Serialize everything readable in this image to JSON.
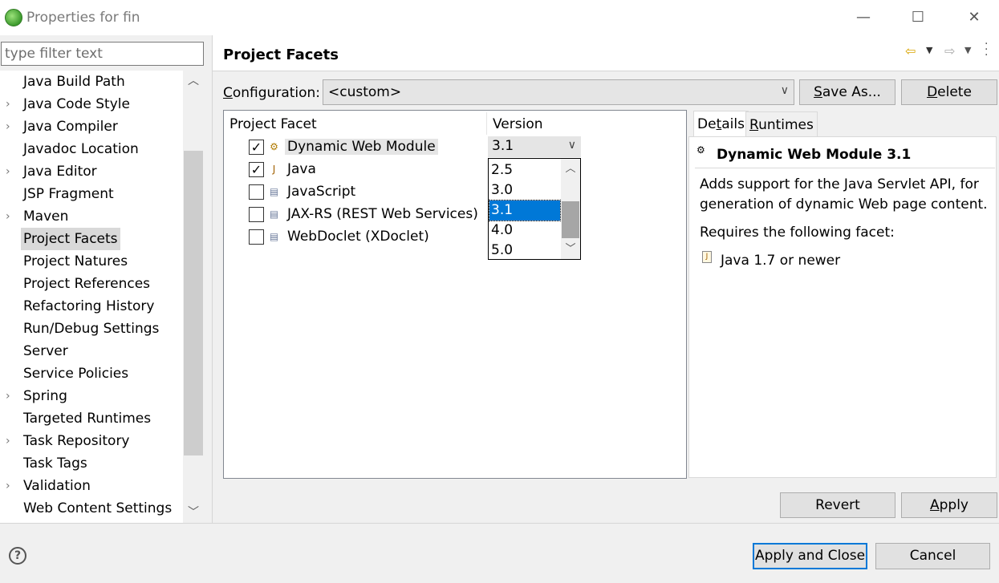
{
  "window": {
    "title": "Properties for fin",
    "controls": {
      "minimize": "—",
      "maximize": "☐",
      "close": "✕"
    }
  },
  "filter": {
    "placeholder": "type filter text",
    "value": ""
  },
  "tree": {
    "items": [
      {
        "label": "Java Build Path",
        "expandable": false
      },
      {
        "label": "Java Code Style",
        "expandable": true
      },
      {
        "label": "Java Compiler",
        "expandable": true
      },
      {
        "label": "Javadoc Location",
        "expandable": false
      },
      {
        "label": "Java Editor",
        "expandable": true
      },
      {
        "label": "JSP Fragment",
        "expandable": false
      },
      {
        "label": "Maven",
        "expandable": true
      },
      {
        "label": "Project Facets",
        "expandable": false,
        "selected": true
      },
      {
        "label": "Project Natures",
        "expandable": false
      },
      {
        "label": "Project References",
        "expandable": false
      },
      {
        "label": "Refactoring History",
        "expandable": false
      },
      {
        "label": "Run/Debug Settings",
        "expandable": false
      },
      {
        "label": "Server",
        "expandable": false
      },
      {
        "label": "Service Policies",
        "expandable": false
      },
      {
        "label": "Spring",
        "expandable": true
      },
      {
        "label": "Targeted Runtimes",
        "expandable": false
      },
      {
        "label": "Task Repository",
        "expandable": true
      },
      {
        "label": "Task Tags",
        "expandable": false
      },
      {
        "label": "Validation",
        "expandable": true
      },
      {
        "label": "Web Content Settings",
        "expandable": false
      }
    ]
  },
  "page": {
    "title": "Project Facets"
  },
  "configuration": {
    "label_prefix": "C",
    "label_rest": "onfiguration:",
    "value": "<custom>",
    "save_as_u": "S",
    "save_as_rest": "ave As...",
    "delete_u": "D",
    "delete_rest": "elete"
  },
  "facets": {
    "col_facet": "Project Facet",
    "col_version": "Version",
    "rows": [
      {
        "name": "Dynamic Web Module",
        "checked": true,
        "icon": "web-module-icon"
      },
      {
        "name": "Java",
        "checked": true,
        "icon": "java-icon"
      },
      {
        "name": "JavaScript",
        "checked": false,
        "icon": "document-icon"
      },
      {
        "name": "JAX-RS (REST Web Services)",
        "checked": false,
        "icon": "document-icon"
      },
      {
        "name": "WebDoclet (XDoclet)",
        "checked": false,
        "icon": "document-icon"
      }
    ],
    "version_selected": "3.1",
    "version_options": [
      "2.5",
      "3.0",
      "3.1",
      "4.0",
      "5.0"
    ]
  },
  "details": {
    "tab_details_pre": "De",
    "tab_details_u": "t",
    "tab_details_post": "ails",
    "tab_runtimes_u": "R",
    "tab_runtimes_rest": "untimes",
    "title": "Dynamic Web Module 3.1",
    "description": "Adds support for the Java Servlet API, for generation of dynamic Web page content.",
    "requires": "Requires the following facet:",
    "required_facet": "Java 1.7 or newer"
  },
  "buttons": {
    "revert": "Revert",
    "apply_u": "A",
    "apply_rest": "pply",
    "apply_close": "Apply and Close",
    "cancel": "Cancel"
  },
  "colors": {
    "accent": "#0078d7",
    "nav_arrow": "#d9a400"
  }
}
